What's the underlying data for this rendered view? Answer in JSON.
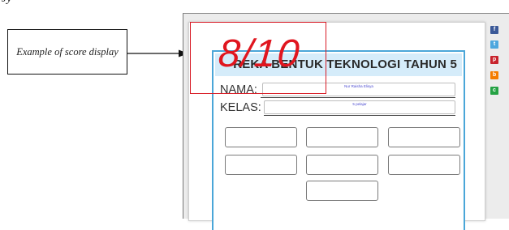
{
  "top_text": "Jy",
  "callout": {
    "text": "Example of score display"
  },
  "worksheet": {
    "title": "REKA BENTUK TEKNOLOGI TAHUN 5",
    "fields": [
      {
        "label": "NAMA:",
        "value": "Nur Raisha Elisya"
      },
      {
        "label": "KELAS:",
        "value": "5 pelajar"
      }
    ],
    "answer_box_count": 7
  },
  "score": {
    "text": "8/10",
    "color": "#e0161f"
  },
  "share_icons": [
    {
      "name": "facebook-icon",
      "glyph": "f",
      "color": "#3b5998"
    },
    {
      "name": "twitter-icon",
      "glyph": "t",
      "color": "#4da7de"
    },
    {
      "name": "pinterest-icon",
      "glyph": "p",
      "color": "#c8232c"
    },
    {
      "name": "blogger-icon",
      "glyph": "b",
      "color": "#f57d00"
    },
    {
      "name": "classroom-icon",
      "glyph": "c",
      "color": "#25a244"
    }
  ]
}
